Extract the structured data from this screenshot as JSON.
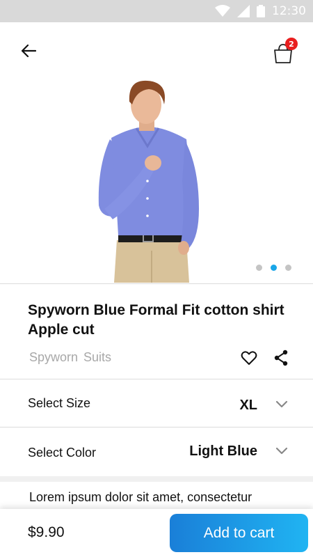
{
  "status_bar": {
    "time": "12:30",
    "icons": [
      "wifi-icon",
      "signal-icon",
      "battery-icon"
    ]
  },
  "nav": {
    "cart_count": "2"
  },
  "product": {
    "title": "Spyworn Blue Formal Fit cotton shirt Apple cut",
    "brand": "Spyworn",
    "category": "Suits",
    "image_description": "Model wearing a blue formal shirt with beige trousers",
    "carousel": {
      "count": 3,
      "active_index": 1
    }
  },
  "options": {
    "size": {
      "label": "Select Size",
      "value": "XL"
    },
    "color": {
      "label": "Select Color",
      "value": "Light Blue"
    }
  },
  "description": "Lorem ipsum dolor sit amet, consectetur",
  "footer": {
    "price": "$9.90",
    "add_to_cart_label": "Add to cart"
  },
  "colors": {
    "accent_start": "#1a7fd8",
    "accent_end": "#20b4f2",
    "badge": "#e91e1e",
    "active_dot": "#1aa6e8",
    "shirt": "#7f8ce0",
    "trousers": "#d8c29a"
  }
}
